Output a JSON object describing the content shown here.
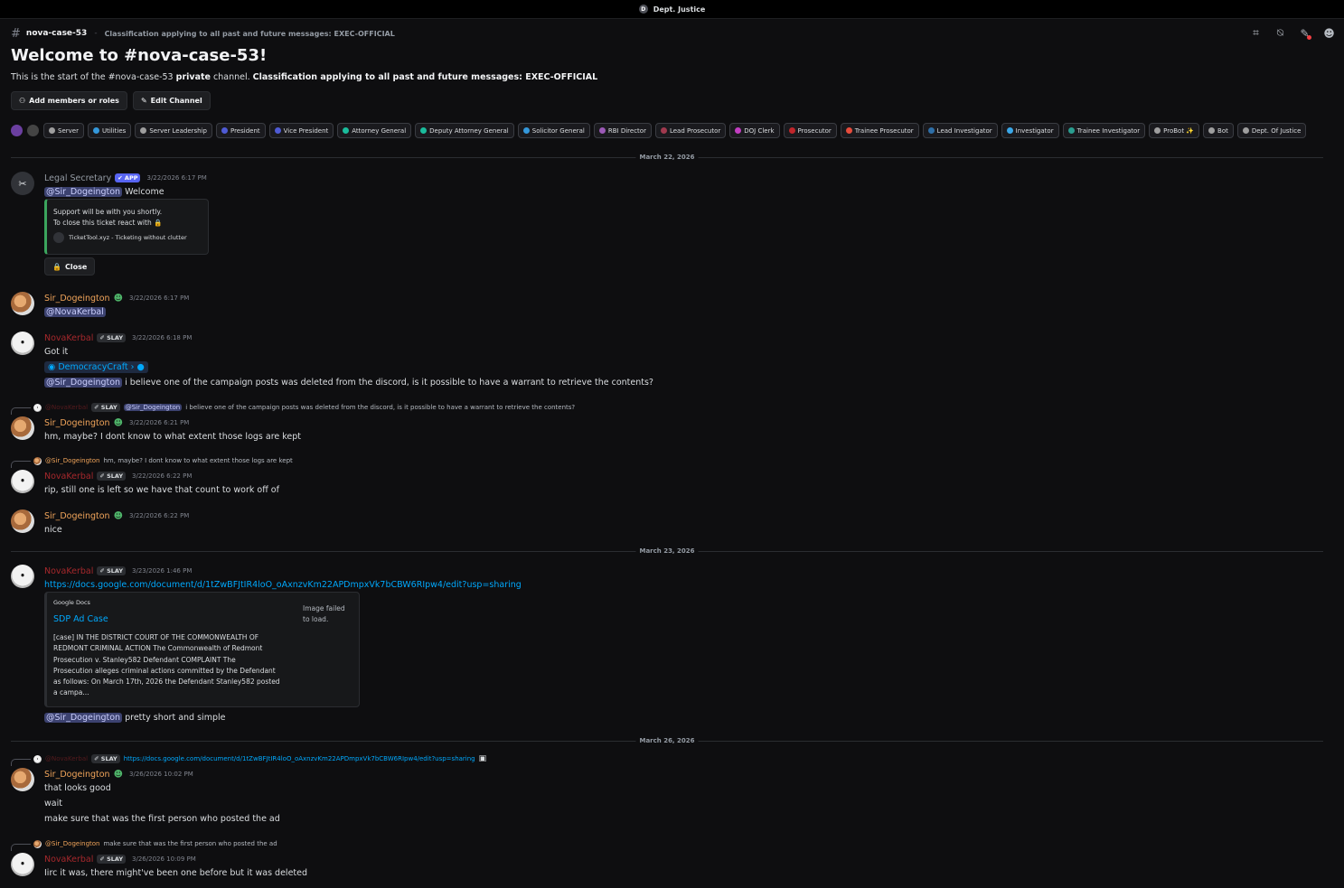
{
  "topbar": {
    "server_icon": "D",
    "server_name": "Dept. Justice"
  },
  "channel": {
    "name": "nova-case-53",
    "topic": "Classification applying to all past and future messages: EXEC-OFFICIAL",
    "tools": [
      "threads-icon",
      "mute-icon",
      "pins-icon",
      "members-icon"
    ]
  },
  "welcome": {
    "title": "Welcome to #nova-case-53!",
    "desc_pre": "This is the start of the #nova-case-53",
    "desc_bold1": "private",
    "desc_mid": "channel.",
    "desc_bold2": "Classification applying to all past and future messages: EXEC-OFFICIAL",
    "add_btn": "Add members or roles",
    "edit_btn": "Edit Channel"
  },
  "roles": [
    {
      "label": "Server",
      "color": "#9e9e9e"
    },
    {
      "label": "Utilities",
      "color": "#3498db"
    },
    {
      "label": "Server Leadership",
      "color": "#9e9e9e"
    },
    {
      "label": "President",
      "color": "#4f5bd5"
    },
    {
      "label": "Vice President",
      "color": "#4f5bd5"
    },
    {
      "label": "Attorney General",
      "color": "#1abc9c"
    },
    {
      "label": "Deputy Attorney General",
      "color": "#1abc9c"
    },
    {
      "label": "Solicitor General",
      "color": "#3498db"
    },
    {
      "label": "RBI Director",
      "color": "#9b59b6"
    },
    {
      "label": "Lead Prosecutor",
      "color": "#a0394e"
    },
    {
      "label": "DOJ Clerk",
      "color": "#c23ec2"
    },
    {
      "label": "Prosecutor",
      "color": "#c0262b"
    },
    {
      "label": "Trainee Prosecutor",
      "color": "#e74c3c"
    },
    {
      "label": "Lead Investigator",
      "color": "#2e6fa8"
    },
    {
      "label": "Investigator",
      "color": "#3aa7e8"
    },
    {
      "label": "Trainee Investigator",
      "color": "#2a9d8f"
    },
    {
      "label": "ProBot ✨",
      "color": "#9e9e9e"
    },
    {
      "label": "Bot",
      "color": "#9e9e9e"
    },
    {
      "label": "Dept. Of Justice",
      "color": "#9e9e9e"
    }
  ],
  "dividers": [
    "March 22, 2026",
    "March 23, 2026",
    "March 26, 2026"
  ],
  "users": {
    "sir": "Sir_Dogeington",
    "nova": "NovaKerbal",
    "legal": "Legal Secretary"
  },
  "tags": {
    "app": "✔ APP",
    "slay": "✐ SLAY"
  },
  "m1": {
    "time": "3/22/2026 6:17 PM",
    "mention": "@Sir_Dogeington",
    "text": "Welcome",
    "embed_line1": "Support will be with you shortly.",
    "embed_line2": "To close this ticket react with",
    "embed_footer": "TicketTool.xyz - Ticketing without clutter",
    "close": "Close"
  },
  "m2": {
    "time": "3/22/2026 6:17 PM",
    "mention": "@NovaKerbal"
  },
  "m3": {
    "time": "3/22/2026 6:18 PM",
    "line1": "Got it",
    "chip": "DemocracyCraft",
    "mention": "@Sir_Dogeington",
    "line3": "i believe one of the campaign posts was deleted from the discord, is it possible to have a warrant to retrieve the contents?"
  },
  "m4": {
    "reply_name": "@NovaKerbal",
    "reply_mention": "@Sir_Dogeington",
    "reply_text": "i believe one of the campaign posts was deleted from the discord, is it possible to have a warrant to retrieve the contents?",
    "time": "3/22/2026 6:21 PM",
    "text": "hm, maybe? I dont know to what extent those logs are kept"
  },
  "m5": {
    "reply_name": "@Sir_Dogeington",
    "reply_text": "hm, maybe? I dont know to what extent those logs are kept",
    "time": "3/22/2026 6:22 PM",
    "text": "rip, still one is left so we have that count to work off of"
  },
  "m6": {
    "time": "3/22/2026 6:22 PM",
    "text": "nice"
  },
  "m7": {
    "time": "3/23/2026 1:46 PM",
    "link": "https://docs.google.com/document/d/1tZwBFJtIR4loO_oAxnzvKm22APDmpxVk7bCBW6RIpw4/edit?usp=sharing",
    "embed_provider": "Google Docs",
    "embed_title": "SDP Ad Case",
    "embed_desc": [
      "[case] IN THE DISTRICT COURT OF THE COMMONWEALTH OF",
      "REDMONT CRIMINAL ACTION The Commonwealth of Redmont",
      "Prosecution v. Stanley582 Defendant COMPLAINT The",
      "Prosecution alleges criminal actions committed by the Defendant",
      "as follows: On March 17th, 2026 the Defendant Stanley582 posted",
      "a campa..."
    ],
    "img_fail_1": "Image failed",
    "img_fail_2": "to load.",
    "mention": "@Sir_Dogeington",
    "after": "pretty short and simple"
  },
  "m8": {
    "reply_name": "@NovaKerbal",
    "reply_link": "https://docs.google.com/document/d/1tZwBFJtIR4loO_oAxnzvKm22APDmpxVk7bCBW6RIpw4/edit?usp=sharing",
    "time": "3/26/2026 10:02 PM",
    "lines": [
      "that looks good",
      "wait",
      "make sure that was the first person who posted the ad"
    ]
  },
  "m9": {
    "reply_name": "@Sir_Dogeington",
    "reply_text": "make sure that was the first person who posted the ad",
    "time": "3/26/2026 10:09 PM",
    "text": "Iirc it was, there might've been one before but it was deleted"
  }
}
